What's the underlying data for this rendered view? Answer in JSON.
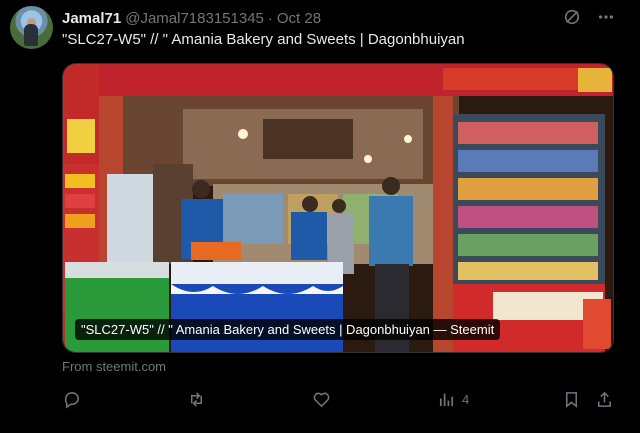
{
  "tweet": {
    "name": "Jamal71",
    "handle": "@Jamal7183151345",
    "separator": "·",
    "date": "Oct 28",
    "text": "\"SLC27-W5\" // \" Amania Bakery and Sweets | Dagonbhuiyan"
  },
  "card": {
    "caption": "\"SLC27-W5\" // \" Amania Bakery and Sweets | Dagonbhuiyan — Steemit",
    "source": "From steemit.com"
  },
  "metrics": {
    "views": "4"
  },
  "icons": {
    "grok": "grok-icon",
    "more": "more-icon",
    "reply": "reply-icon",
    "retweet": "retweet-icon",
    "like": "like-icon",
    "views": "views-icon",
    "bookmark": "bookmark-icon",
    "share": "share-icon"
  },
  "colors": {
    "background": "#000000",
    "text": "#e7e9ea",
    "muted": "#71767b"
  }
}
